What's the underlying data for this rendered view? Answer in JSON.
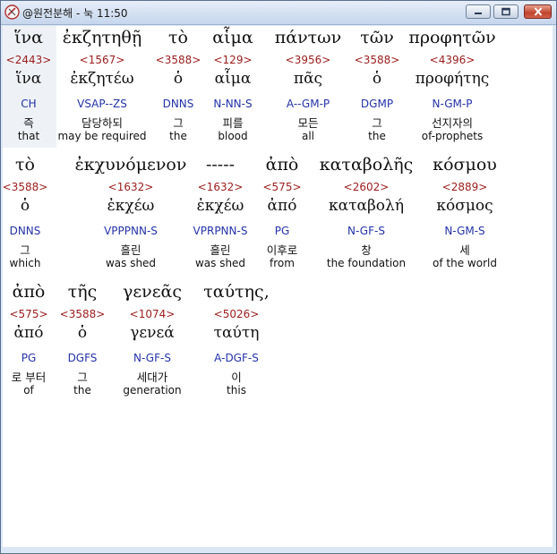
{
  "window": {
    "title": "@원전분해 - 눅 11:50"
  },
  "colors": {
    "strongs": "#9b1c1c",
    "parsing": "#2433a8",
    "text": "#111111"
  },
  "icons": {
    "app": "bible-app-icon",
    "minimize": "minimize-icon",
    "maximize": "maximize-icon",
    "close": "close-icon"
  },
  "lines": [
    [
      {
        "greek": "ἵνα",
        "strong": "<2443>",
        "lemma": "ἵνα",
        "parsing": "CH",
        "korean": "즉",
        "english": "that"
      },
      {
        "greek": "ἐκζητηθῇ",
        "strong": "<1567>",
        "lemma": "ἐκζητέω",
        "parsing": "VSAP--ZS",
        "korean": "담당하되",
        "english": "may be required"
      },
      {
        "greek": "τὸ",
        "strong": "<3588>",
        "lemma": "ὁ",
        "parsing": "DNNS",
        "korean": "그",
        "english": "the"
      },
      {
        "greek": "αἷμα",
        "strong": "<129>",
        "lemma": "αἷμα",
        "parsing": "N-NN-S",
        "korean": "피를",
        "english": "blood"
      },
      {
        "greek": "πάντων",
        "strong": "<3956>",
        "lemma": "πᾶς",
        "parsing": "A--GM-P",
        "korean": "모든",
        "english": "all"
      },
      {
        "greek": "τῶν",
        "strong": "<3588>",
        "lemma": "ὁ",
        "parsing": "DGMP",
        "korean": "그",
        "english": "the"
      },
      {
        "greek": "προφητῶν",
        "strong": "<4396>",
        "lemma": "προφήτης",
        "parsing": "N-GM-P",
        "korean": "선지자의",
        "english": "of-prophets"
      }
    ],
    [
      {
        "greek": "τὸ",
        "strong": "<3588>",
        "lemma": "ὁ",
        "parsing": "DNNS",
        "korean": "그",
        "english": "which"
      },
      {
        "greek": "ἐκχυνόμενον",
        "strong": "<1632>",
        "lemma": "ἐκχέω",
        "parsing": "VPPPNN-S",
        "korean": "흘린",
        "english": "was shed"
      },
      {
        "greek": "-----",
        "strong": "<1632>",
        "lemma": "ἐκχέω",
        "parsing": "VPRPNN-S",
        "korean": "흘린",
        "english": "was shed"
      },
      {
        "greek": "ἀπὸ",
        "strong": "<575>",
        "lemma": "ἀπό",
        "parsing": "PG",
        "korean": "이후로",
        "english": "from"
      },
      {
        "greek": "καταβολῆς",
        "strong": "<2602>",
        "lemma": "καταβολή",
        "parsing": "N-GF-S",
        "korean": "창",
        "english": "the foundation"
      },
      {
        "greek": "κόσμου",
        "strong": "<2889>",
        "lemma": "κόσμος",
        "parsing": "N-GM-S",
        "korean": "세",
        "english": "of the world"
      }
    ],
    [
      {
        "greek": "ἀπὸ",
        "strong": "<575>",
        "lemma": "ἀπό",
        "parsing": "PG",
        "korean": "로 부터",
        "english": "of"
      },
      {
        "greek": "τῆς",
        "strong": "<3588>",
        "lemma": "ὁ",
        "parsing": "DGFS",
        "korean": "그",
        "english": "the"
      },
      {
        "greek": "γενεᾶς",
        "strong": "<1074>",
        "lemma": "γενεά",
        "parsing": "N-GF-S",
        "korean": "세대가",
        "english": "generation"
      },
      {
        "greek": "ταύτης,",
        "strong": "<5026>",
        "lemma": "ταύτη",
        "parsing": "A-DGF-S",
        "korean": "이",
        "english": "this"
      }
    ]
  ]
}
